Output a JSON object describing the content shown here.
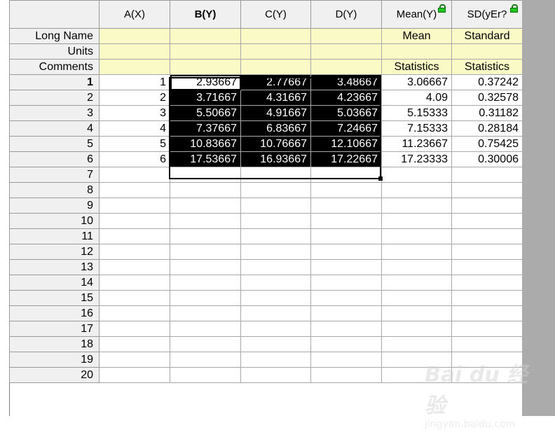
{
  "columns": [
    {
      "label": "A(X)",
      "bold": false
    },
    {
      "label": "B(Y)",
      "bold": true
    },
    {
      "label": "C(Y)",
      "bold": false
    },
    {
      "label": "D(Y)",
      "bold": false
    },
    {
      "label": "Mean(Y)",
      "bold": false,
      "locked": true
    },
    {
      "label": "SD(yEr?",
      "bold": false,
      "locked": true
    }
  ],
  "meta_rows": [
    {
      "label": "Long Name",
      "values": [
        "",
        "",
        "",
        "",
        "Mean",
        "Standard"
      ]
    },
    {
      "label": "Units",
      "values": [
        "",
        "",
        "",
        "",
        "",
        ""
      ]
    },
    {
      "label": "Comments",
      "values": [
        "",
        "",
        "",
        "",
        "Statistics",
        "Statistics"
      ]
    }
  ],
  "data_rows": [
    {
      "n": "1",
      "values": [
        "1",
        "2.93667",
        "2.77667",
        "3.48667",
        "3.06667",
        "0.37242"
      ]
    },
    {
      "n": "2",
      "values": [
        "2",
        "3.71667",
        "4.31667",
        "4.23667",
        "4.09",
        "0.32578"
      ]
    },
    {
      "n": "3",
      "values": [
        "3",
        "5.50667",
        "4.91667",
        "5.03667",
        "5.15333",
        "0.31182"
      ]
    },
    {
      "n": "4",
      "values": [
        "4",
        "7.37667",
        "6.83667",
        "7.24667",
        "7.15333",
        "0.28184"
      ]
    },
    {
      "n": "5",
      "values": [
        "5",
        "10.83667",
        "10.76667",
        "12.10667",
        "11.23667",
        "0.75425"
      ]
    },
    {
      "n": "6",
      "values": [
        "6",
        "17.53667",
        "16.93667",
        "17.22667",
        "17.23333",
        "0.30006"
      ]
    },
    {
      "n": "7",
      "values": [
        "",
        "",
        "",
        "",
        "",
        ""
      ]
    },
    {
      "n": "8",
      "values": [
        "",
        "",
        "",
        "",
        "",
        ""
      ]
    },
    {
      "n": "9",
      "values": [
        "",
        "",
        "",
        "",
        "",
        ""
      ]
    },
    {
      "n": "10",
      "values": [
        "",
        "",
        "",
        "",
        "",
        ""
      ]
    },
    {
      "n": "11",
      "values": [
        "",
        "",
        "",
        "",
        "",
        ""
      ]
    },
    {
      "n": "12",
      "values": [
        "",
        "",
        "",
        "",
        "",
        ""
      ]
    },
    {
      "n": "13",
      "values": [
        "",
        "",
        "",
        "",
        "",
        ""
      ]
    },
    {
      "n": "14",
      "values": [
        "",
        "",
        "",
        "",
        "",
        ""
      ]
    },
    {
      "n": "15",
      "values": [
        "",
        "",
        "",
        "",
        "",
        ""
      ]
    },
    {
      "n": "16",
      "values": [
        "",
        "",
        "",
        "",
        "",
        ""
      ]
    },
    {
      "n": "17",
      "values": [
        "",
        "",
        "",
        "",
        "",
        ""
      ]
    },
    {
      "n": "18",
      "values": [
        "",
        "",
        "",
        "",
        "",
        ""
      ]
    },
    {
      "n": "19",
      "values": [
        "",
        "",
        "",
        "",
        "",
        ""
      ]
    },
    {
      "n": "20",
      "values": [
        "",
        "",
        "",
        "",
        "",
        ""
      ]
    }
  ],
  "selection": {
    "active_cell": "B1",
    "range": "B1:D6"
  },
  "watermark": {
    "line1": "Bai du 经验",
    "line2": "jingyan.baidu.com"
  },
  "colors": {
    "meta_row_bg": "#fafac6",
    "header_bg": "#f0f0f0",
    "selection_bg": "#000000",
    "lock_icon": "#22c422"
  },
  "icons": {
    "locked_column": "lock-icon"
  }
}
